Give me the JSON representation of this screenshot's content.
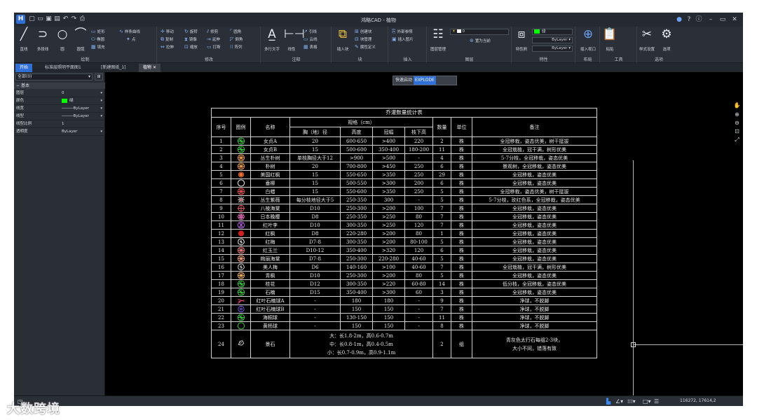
{
  "app": {
    "title": "鸿略CAD - 植物",
    "logo": "H"
  },
  "quick_access": [
    "new-icon",
    "open-icon",
    "save-icon",
    "saveas-icon",
    "undo-icon",
    "redo-icon",
    "print-icon"
  ],
  "window_controls": {
    "user": "user-icon",
    "help": "help-icon",
    "info": "info-icon",
    "minimize": "minimize-icon",
    "maximize": "maximize-icon",
    "close": "close-icon"
  },
  "ribbon": {
    "draw": {
      "label": "绘制",
      "line": "直线",
      "polyline": "多段线",
      "circle": "圆",
      "arc": "圆弧",
      "rect": "矩形",
      "ellipse": "椭圆",
      "fill": "填充",
      "spline": "样条曲线",
      "point": "点"
    },
    "modify": {
      "label": "修改",
      "move": "移动",
      "rotate": "旋转",
      "trim": "修剪",
      "fillet": "圆角",
      "copy": "复制",
      "mirror": "镜像",
      "extend": "延伸",
      "chamfer": "倒角",
      "stretch": "拉伸",
      "scale": "缩放",
      "break": "打断",
      "array": "阵列"
    },
    "annotate": {
      "label": "注释",
      "mtext": "多行文字",
      "dim": "线性",
      "leader": "引线",
      "cloud": "云线",
      "table": "表格"
    },
    "block": {
      "label": "块",
      "insert": "插入块",
      "create": "创建块",
      "manage": "块管理",
      "attdef": "属性定义"
    },
    "insert": {
      "label": "插入",
      "xref": "外部参照",
      "image": "插入图片"
    },
    "layer": {
      "label": "图层",
      "manager": "图层管理",
      "current": "0",
      "match": "置为当前"
    },
    "props": {
      "label": "特性",
      "match": "特性刷",
      "color": "绿",
      "linetype1": "ByLayer",
      "linetype2": "ByLayer"
    },
    "layout": {
      "label": "布局",
      "viewport": "插入视口"
    },
    "tools": {
      "label": "工具",
      "paste": "粘贴"
    },
    "options": {
      "label": "选项",
      "style": "样式设置",
      "options": "选项"
    }
  },
  "doc_tabs": [
    "开始",
    "标准层照明平面图1",
    "[新建图纸_1]",
    "植物"
  ],
  "properties": {
    "selection": "全部(0)",
    "section": "基本",
    "rows": [
      {
        "key": "图层",
        "value": "0"
      },
      {
        "key": "颜色",
        "value": "绿"
      },
      {
        "key": "线宽",
        "value": "ByLayer"
      },
      {
        "key": "线型",
        "value": "ByLayer"
      },
      {
        "key": "线型比例",
        "value": "1"
      },
      {
        "key": "透明度",
        "value": "ByLayer"
      }
    ]
  },
  "command": {
    "prefix": "快速启动",
    "value": "EXPLODE"
  },
  "plant_table": {
    "title": "乔灌数量统计表",
    "headers": {
      "no": "序号",
      "legend": "图例",
      "name": "名称",
      "spec": "规格（cm）",
      "dbh": "胸（地）径",
      "height": "高度",
      "crown": "冠幅",
      "branch": "枝下高",
      "qty": "数量",
      "unit": "单位",
      "note": "备注"
    },
    "rows": [
      {
        "no": "1",
        "name": "女贞A",
        "dbh": "20",
        "height": "600-650",
        "crown": ">400",
        "branch": "220",
        "qty": "2",
        "unit": "株",
        "note": "全冠移栽，姿态优美，树干挺拔",
        "icon": "ring-tree",
        "color": "#3cd23c"
      },
      {
        "no": "2",
        "name": "女贞B",
        "dbh": "15",
        "height": "500-600",
        "crown": "350-400",
        "branch": "180-200",
        "qty": "11",
        "unit": "株",
        "note": "全冠栽植，冠干满，树形优美",
        "icon": "ring-tree",
        "color": "#3cd23c"
      },
      {
        "no": "3",
        "name": "丛生朴树",
        "dbh": "单枝胸径大于12",
        "height": ">900",
        "crown": ">500",
        "branch": "-",
        "qty": "4",
        "unit": "株",
        "note": "5-7分枝，全冠移栽，姿态优美",
        "icon": "spoke-tree",
        "color": "#f0a050"
      },
      {
        "no": "4",
        "name": "朴树",
        "dbh": "20",
        "height": "700-800",
        "crown": ">450",
        "branch": "250",
        "qty": "6",
        "unit": "株",
        "note": "景观树，全冠移栽，姿态优美",
        "icon": "spoke-tree",
        "color": "#f0a050"
      },
      {
        "no": "5",
        "name": "美国红枫",
        "dbh": "15",
        "height": "550-650",
        "crown": ">350",
        "branch": "250",
        "qty": "29",
        "unit": "株",
        "note": "全冠移栽，姿态优美",
        "icon": "small-dot",
        "color": "#f07030"
      },
      {
        "no": "6",
        "name": "垂柳",
        "dbh": "15",
        "height": "500-550",
        "crown": ">300",
        "branch": "200",
        "qty": "6",
        "unit": "株",
        "note": "全冠移栽，姿态优美",
        "icon": "open-circle",
        "color": "#ffffff"
      },
      {
        "no": "7",
        "name": "白蜡",
        "dbh": "15",
        "height": "550-600",
        "crown": ">350",
        "branch": "250",
        "qty": "5",
        "unit": "株",
        "note": "全冠移栽，姿态优美，树干挺拔",
        "icon": "spoke-tree",
        "color": "#f05050"
      },
      {
        "no": "8",
        "name": "丛生紫薇",
        "dbh": "每分枝地径大于5",
        "height": "250-350",
        "crown": "300",
        "branch": "-",
        "qty": "5",
        "unit": "株",
        "note": "5-7分枝，玫红色系，全冠移栽，姿态优美",
        "icon": "star-shrub",
        "color": "#ffffff"
      },
      {
        "no": "9",
        "name": "八棱海棠",
        "dbh": "D10",
        "height": "250-300",
        "crown": ">200",
        "branch": "100",
        "qty": "7",
        "unit": "株",
        "note": "全冠移栽，姿态优美",
        "icon": "cross-tree",
        "color": "#f06060"
      },
      {
        "no": "10",
        "name": "日本晚樱",
        "dbh": "D8",
        "height": "250-350",
        "crown": ">250",
        "branch": "80",
        "qty": "7",
        "unit": "株",
        "note": "全冠移栽，姿态优美",
        "icon": "flower",
        "color": "#f070c0"
      },
      {
        "no": "11",
        "name": "红叶李",
        "dbh": "D10",
        "height": "300-350",
        "crown": ">250",
        "branch": "120",
        "qty": "7",
        "unit": "株",
        "note": "全冠移栽，姿态优美",
        "icon": "x-tree",
        "color": "#c060f0"
      },
      {
        "no": "12",
        "name": "红枫",
        "dbh": "D8",
        "height": "220-280",
        "crown": ">200",
        "branch": "80",
        "qty": "1",
        "unit": "株",
        "note": "全冠移栽，姿态优美",
        "icon": "solid-dot",
        "color": "#d02020"
      },
      {
        "no": "13",
        "name": "红梅",
        "dbh": "D7-8",
        "height": "300-350",
        "crown": ">200",
        "branch": "80-100",
        "qty": "5",
        "unit": "株",
        "note": "全冠移栽，姿态优美",
        "icon": "wavy-tree",
        "color": "#ffffff"
      },
      {
        "no": "14",
        "name": "红玉兰",
        "dbh": "D10-12",
        "height": "350-400",
        "crown": ">320",
        "branch": "120",
        "qty": "6",
        "unit": "株",
        "note": "全冠移栽，姿态优美",
        "icon": "spoke-tree",
        "color": "#f08080"
      },
      {
        "no": "15",
        "name": "绚丽海棠",
        "dbh": "D7-8",
        "height": "250-300",
        "crown": "220-280",
        "branch": "40-60",
        "qty": "5",
        "unit": "株",
        "note": "全冠移栽，姿态优美",
        "icon": "spoke-tree",
        "color": "#f0a070"
      },
      {
        "no": "16",
        "name": "美人梅",
        "dbh": "D6",
        "height": "140-160",
        "crown": ">100",
        "branch": "40-60",
        "qty": "7",
        "unit": "株",
        "note": "全冠栽植，冠干满，树形优美",
        "icon": "wavy-tree",
        "color": "#e0e0e0"
      },
      {
        "no": "17",
        "name": "青枫",
        "dbh": "D10",
        "height": "250-300",
        "crown": ">200",
        "branch": "80",
        "qty": "5",
        "unit": "株",
        "note": "全冠移栽，姿态优美",
        "icon": "spoke-tree",
        "color": "#f0b060"
      },
      {
        "no": "18",
        "name": "桂花",
        "dbh": "D12",
        "height": "300-350",
        "crown": ">220",
        "branch": "60-80",
        "qty": "14",
        "unit": "株",
        "note": "低分枝，全冠移栽，姿态优美",
        "icon": "ring-tree",
        "color": "#3cd23c"
      },
      {
        "no": "19",
        "name": "石楠",
        "dbh": "D15",
        "height": "350-400",
        "crown": ">300",
        "branch": "60",
        "qty": "3",
        "unit": "株",
        "note": "全冠移栽，姿态优美",
        "icon": "ring-tree",
        "color": "#3cd23c"
      },
      {
        "no": "20",
        "name": "红叶石楠球A",
        "dbh": "-",
        "height": "180",
        "crown": "180",
        "branch": "-",
        "qty": "9",
        "unit": "株",
        "note": "净球，不脱脚",
        "icon": "fan-shrub",
        "color": "#f04080"
      },
      {
        "no": "21",
        "name": "红叶石楠球B",
        "dbh": "-",
        "height": "150",
        "crown": "150",
        "branch": "-",
        "qty": "7",
        "unit": "株",
        "note": "净球，不脱脚",
        "icon": "ball",
        "color": "#8060f0"
      },
      {
        "no": "22",
        "name": "海桐球",
        "dbh": "-",
        "height": "130-150",
        "crown": "150",
        "branch": "-",
        "qty": "11",
        "unit": "株",
        "note": "净球，不脱脚",
        "icon": "ring-tree",
        "color": "#3cd23c"
      },
      {
        "no": "23",
        "name": "黄杨球",
        "dbh": "-",
        "height": "150",
        "crown": "150",
        "branch": "-",
        "qty": "8",
        "unit": "株",
        "note": "净球，不脱脚",
        "icon": "open-circle",
        "color": "#3cd23c"
      }
    ],
    "stone": {
      "no": "24",
      "name": "景石",
      "spec1": "大：长1.8-2m，高0.6-0.7m",
      "spec2": "中：长0.8-1m，高0.4-0.5m",
      "spec3": "小：长0.7-0.9m，高0.9-1.1m",
      "qty": "2",
      "unit": "组",
      "note1": "青灰色太行石每组2-3块，",
      "note2": "大小不同，错落有致"
    }
  },
  "status": {
    "coords": "116272, 17614,2"
  },
  "watermark": "大数跨境"
}
